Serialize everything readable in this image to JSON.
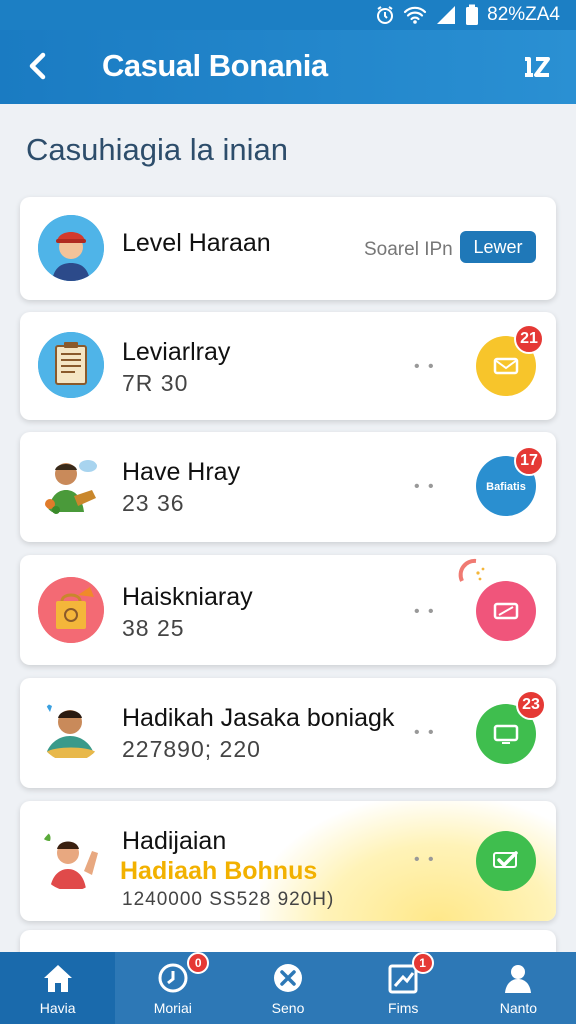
{
  "status_bar": {
    "text": "82%ZA4"
  },
  "app_bar": {
    "title": "Casual Bonania"
  },
  "section_title": "Casuhiagia la inian",
  "cards": [
    {
      "title": "Level Haraan",
      "tag_label": "Soarel IPn",
      "tag_button": "Lewer"
    },
    {
      "title": "Leviarlray",
      "subtitle": "7R 30",
      "badge": "21",
      "color": "#f7c52b"
    },
    {
      "title": "Have Hray",
      "subtitle": "23 36",
      "badge": "17",
      "color": "#2a8fd0",
      "circle_label": "Bafiatis"
    },
    {
      "title": "Haiskniaray",
      "subtitle": "38 25",
      "color": "#f0557b"
    },
    {
      "title": "Hadikah Jasaka boniagk",
      "subtitle": "227890; 220",
      "badge": "23",
      "color": "#3fbe4e"
    },
    {
      "title": "Hadijaian",
      "bonus": "Hadiaah Bohnus",
      "subtitle": "1240000 SS528 920H)",
      "color": "#3fbe4e"
    }
  ],
  "bottom_nav": [
    {
      "label": "Havia",
      "icon": "home-icon"
    },
    {
      "label": "Moriai",
      "icon": "clock-icon",
      "badge": "0"
    },
    {
      "label": "Seno",
      "icon": "close-circle-icon"
    },
    {
      "label": "Fims",
      "icon": "chart-icon",
      "badge": "1"
    },
    {
      "label": "Nanto",
      "icon": "person-icon"
    }
  ]
}
